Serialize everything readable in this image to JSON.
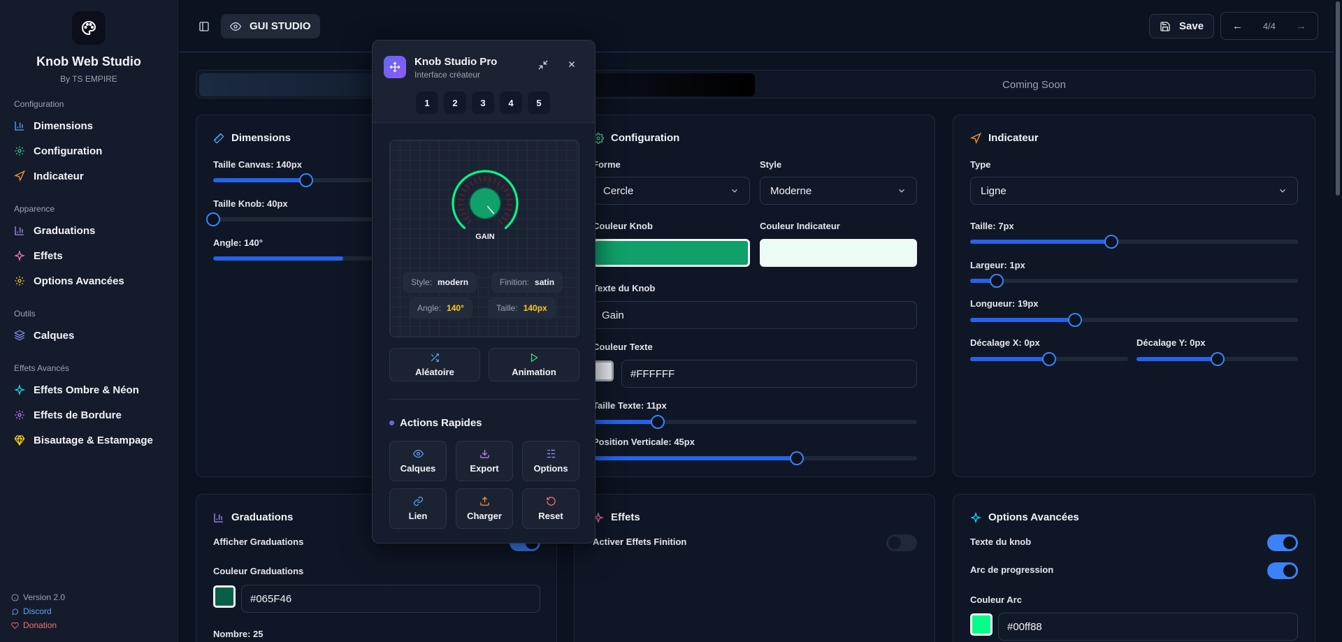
{
  "brand": {
    "title": "Knob Web Studio",
    "subtitle": "By TS EMPIRE"
  },
  "sidebar": {
    "sections": [
      {
        "title": "Configuration",
        "items": [
          {
            "label": "Dimensions",
            "icon": "bar-chart-icon",
            "color": "#60a5fa"
          },
          {
            "label": "Configuration",
            "icon": "gear-icon",
            "color": "#34d399"
          },
          {
            "label": "Indicateur",
            "icon": "navigation-icon",
            "color": "#fb923c"
          }
        ]
      },
      {
        "title": "Apparence",
        "items": [
          {
            "label": "Graduations",
            "icon": "bar-chart-icon",
            "color": "#a78bfa"
          },
          {
            "label": "Effets",
            "icon": "sparkles-icon",
            "color": "#f472b6"
          },
          {
            "label": "Options Avancées",
            "icon": "gear-icon",
            "color": "#fbbf24"
          }
        ]
      },
      {
        "title": "Outils",
        "items": [
          {
            "label": "Calques",
            "icon": "layers-icon",
            "color": "#818cf8"
          }
        ]
      },
      {
        "title": "Effets Avancés",
        "items": [
          {
            "label": "Effets Ombre & Néon",
            "icon": "sparkles-icon",
            "color": "#22d3ee"
          },
          {
            "label": "Effets de Bordure",
            "icon": "gear-icon",
            "color": "#c084fc"
          },
          {
            "label": "Bisautage & Estampage",
            "icon": "gem-icon",
            "color": "#facc15"
          }
        ]
      }
    ],
    "footer": {
      "version": "Version 2.0",
      "discord": "Discord",
      "donation": "Donation"
    }
  },
  "header": {
    "gui_label": "GUI STUDIO",
    "save_label": "Save",
    "pager": {
      "prev": "←",
      "page": "4/4",
      "next": "→"
    }
  },
  "tabs": {
    "soon_label": "Coming Soon"
  },
  "dimensions": {
    "title": "Dimensions",
    "canvas_label": "Taille Canvas: 140px",
    "canvas_value": 0.43,
    "knob_label": "Taille Knob: 40px",
    "knob_value": 0.0,
    "angle_label": "Angle: 140°",
    "angle_value": 0.6
  },
  "configuration": {
    "title": "Configuration",
    "forme_label": "Forme",
    "forme_value": "Cercle",
    "style_label": "Style",
    "style_value": "Moderne",
    "couleur_knob_label": "Couleur Knob",
    "couleur_knob": "#10a06a",
    "couleur_indicateur_label": "Couleur Indicateur",
    "couleur_indicateur": "#ecfdf5",
    "texte_label": "Texte du Knob",
    "texte_value": "Gain",
    "couleur_texte_label": "Couleur Texte",
    "couleur_texte_value": "#FFFFFF",
    "taille_texte_label": "Taille Texte: 11px",
    "taille_texte_value": 0.2,
    "position_label": "Position Verticale: 45px",
    "position_value": 0.63
  },
  "indicateur": {
    "title": "Indicateur",
    "type_label": "Type",
    "type_value": "Ligne",
    "taille_label": "Taille: 7px",
    "taille_value": 0.43,
    "largeur_label": "Largeur: 1px",
    "largeur_value": 0.08,
    "longueur_label": "Longueur: 19px",
    "longueur_value": 0.32,
    "decx_label": "Décalage X: 0px",
    "decx_value": 0.5,
    "decy_label": "Décalage Y: 0px",
    "decy_value": 0.5
  },
  "graduations": {
    "title": "Graduations",
    "afficher_label": "Afficher Graduations",
    "afficher_on": true,
    "couleur_label": "Couleur Graduations",
    "couleur_value": "#065F46",
    "nombre_label": "Nombre: 25"
  },
  "effets": {
    "title": "Effets",
    "finition_label": "Activer Effets Finition",
    "finition_on": false
  },
  "options": {
    "title": "Options Avancées",
    "texte_label": "Texte du knob",
    "texte_on": true,
    "arc_label": "Arc de progression",
    "arc_on": true,
    "couleur_arc_label": "Couleur Arc",
    "couleur_arc_value": "#00ff88"
  },
  "panel": {
    "title": "Knob Studio Pro",
    "subtitle": "Interface créateur",
    "numbers": [
      "1",
      "2",
      "3",
      "4",
      "5"
    ],
    "knob_text": "GAIN",
    "chips": {
      "style_key": "Style:",
      "style_val": "modern",
      "finition_key": "Finition:",
      "finition_val": "satin",
      "angle_key": "Angle:",
      "angle_val": "140°",
      "taille_key": "Taille:",
      "taille_val": "140px"
    },
    "random_label": "Aléatoire",
    "animation_label": "Animation",
    "quick_title": "Actions Rapides",
    "quick": {
      "calques": "Calques",
      "export": "Export",
      "options": "Options",
      "lien": "Lien",
      "charger": "Charger",
      "reset": "Reset"
    }
  }
}
